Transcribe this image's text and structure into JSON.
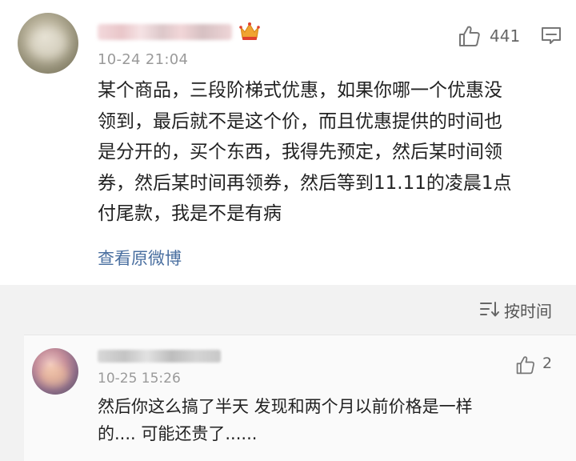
{
  "main_comment": {
    "timestamp": "10-24 21:04",
    "like_count": "441",
    "lines": [
      "某个商品，三段阶梯式优惠，如果你哪一个优惠没",
      "领到，最后就不是这个价，而且优惠提供的时间也",
      "是分开的，买个东西，我得先预定，然后某时间领",
      "券，然后某时间再领券，然后等到11.11的凌晨1点",
      "付尾款，我是不是有病"
    ],
    "view_original_label": "查看原微博"
  },
  "sort_bar": {
    "label": "按时间"
  },
  "reply": {
    "timestamp": "10-25 15:26",
    "like_count": "2",
    "lines": [
      "然后你这么搞了半天 发现和两个月以前价格是一样",
      "的.... 可能还贵了......"
    ]
  },
  "colors": {
    "link_blue": "#4a6fa0",
    "crown_gold": "#f0a431",
    "crown_red": "#e0412f",
    "text_main": "#222222",
    "meta_gray": "#9a9a9a"
  },
  "icons": {
    "crown": "crown-icon",
    "like": "thumbs-up-icon",
    "reply": "comment-bubble-icon",
    "sort": "sort-lines-icon"
  }
}
